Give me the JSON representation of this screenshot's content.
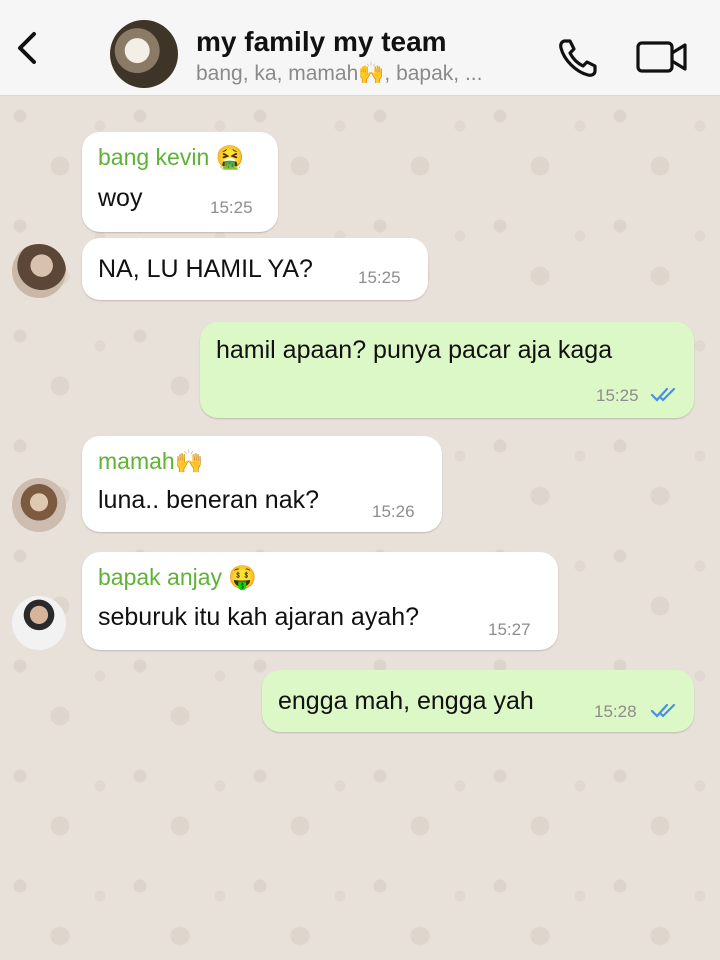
{
  "header": {
    "title": "my family my team",
    "subtitle": "bang, ka, mamah🙌, bapak, ..."
  },
  "messages": [
    {
      "direction": "incoming",
      "sender": "bang kevin 🤮",
      "text": "woy",
      "time": "15:25"
    },
    {
      "direction": "incoming",
      "sender": "",
      "text": "NA, LU HAMIL YA?",
      "time": "15:25"
    },
    {
      "direction": "outgoing",
      "text": "hamil apaan? punya pacar aja kaga",
      "time": "15:25",
      "status": "read"
    },
    {
      "direction": "incoming",
      "sender": "mamah🙌",
      "text": "luna.. beneran nak?",
      "time": "15:26"
    },
    {
      "direction": "incoming",
      "sender": "bapak anjay 🤑",
      "text": "seburuk itu kah ajaran ayah?",
      "time": "15:27"
    },
    {
      "direction": "outgoing",
      "text": "engga mah, engga yah",
      "time": "15:28",
      "status": "read"
    }
  ],
  "colors": {
    "incoming_bubble": "#ffffff",
    "outgoing_bubble": "#dcf8c6",
    "sender_name": "#5fb236",
    "read_ticks": "#4a90e2",
    "header_bg": "#f6f6f6"
  },
  "icons": {
    "back": "chevron-left-icon",
    "call": "phone-icon",
    "video": "video-camera-icon",
    "read_status": "double-check-icon"
  }
}
